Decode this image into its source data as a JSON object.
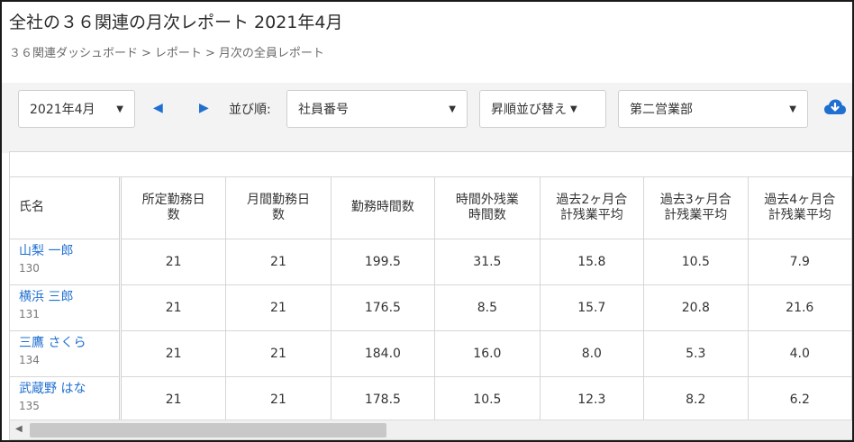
{
  "header": {
    "title": "全社の３６関連の月次レポート 2021年4月",
    "breadcrumb": [
      "３６関連ダッシュボード",
      "レポート",
      "月次の全員レポート"
    ],
    "breadcrumb_sep": ">"
  },
  "toolbar": {
    "month_select": "2021年4月",
    "prev_icon": "triangle-left-icon",
    "next_icon": "triangle-right-icon",
    "sort_label": "並び順:",
    "sort_field": "社員番号",
    "sort_order": "昇順並び替え",
    "department": "第二営業部",
    "download_icon": "cloud-download-icon"
  },
  "table": {
    "headers": [
      [
        "氏名"
      ],
      [
        "所定勤務日",
        "数"
      ],
      [
        "月間勤務日",
        "数"
      ],
      [
        "勤務時間数"
      ],
      [
        "時間外残業",
        "時間数"
      ],
      [
        "過去2ヶ月合",
        "計残業平均"
      ],
      [
        "過去3ヶ月合",
        "計残業平均"
      ],
      [
        "過去4ヶ月合",
        "計残業平均"
      ]
    ],
    "rows": [
      {
        "name": "山梨 一郎",
        "id": "130",
        "values": [
          "21",
          "21",
          "199.5",
          "31.5",
          "15.8",
          "10.5",
          "7.9"
        ]
      },
      {
        "name": "横浜 三郎",
        "id": "131",
        "values": [
          "21",
          "21",
          "176.5",
          "8.5",
          "15.7",
          "20.8",
          "21.6"
        ]
      },
      {
        "name": "三鷹 さくら",
        "id": "134",
        "values": [
          "21",
          "21",
          "184.0",
          "16.0",
          "8.0",
          "5.3",
          "4.0"
        ]
      },
      {
        "name": "武蔵野 はな",
        "id": "135",
        "values": [
          "21",
          "21",
          "178.5",
          "10.5",
          "12.3",
          "8.2",
          "6.2"
        ]
      }
    ]
  },
  "colors": {
    "link": "#1f6fd1",
    "toolbar_bg": "#f3f3f3",
    "border": "#d6d6d6"
  }
}
